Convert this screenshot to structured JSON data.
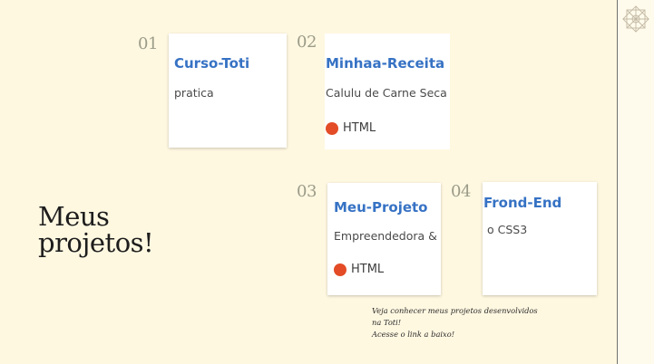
{
  "section": {
    "title_line1": "Meus",
    "title_line2": "projetos!"
  },
  "projects": [
    {
      "number": "01",
      "name": "Curso-Toti",
      "description": "pratica",
      "language": "",
      "language_color": ""
    },
    {
      "number": "02",
      "name": "Minhaa-Receita",
      "description": "Calulu de Carne Seca c",
      "language": "HTML",
      "language_color": "#e34c26"
    },
    {
      "number": "03",
      "name": "Meu-Projeto",
      "description": "Empreendedora & I",
      "language": "HTML",
      "language_color": "#e34c26"
    },
    {
      "number": "04",
      "name": "Frond-End",
      "description": "o CSS3",
      "language": "",
      "language_color": ""
    }
  ],
  "note": {
    "line1": "Veja conhecer meus projetos desenvolvidos",
    "line2": "na Toti!",
    "line3": "Acesse o link a baixo!"
  },
  "colors": {
    "background": "#fff8e1",
    "link": "#3672c4",
    "number": "#9b9c88"
  },
  "icons": {
    "brand": "geometric-star-icon"
  }
}
